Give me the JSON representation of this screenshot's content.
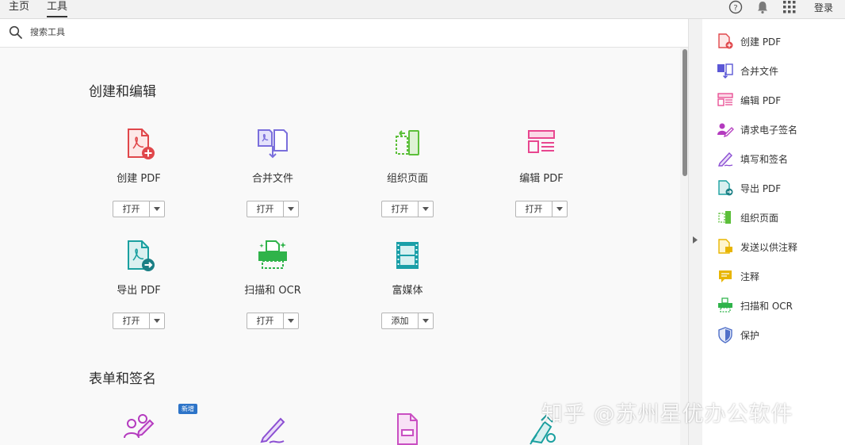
{
  "topbar": {
    "tabs": [
      {
        "label": "主页",
        "active": false
      },
      {
        "label": "工具",
        "active": true
      }
    ],
    "icons": [
      "help-icon",
      "bell-icon",
      "apps-grid-icon"
    ],
    "login_label": "登录"
  },
  "search": {
    "placeholder": "搜索工具"
  },
  "sections": [
    {
      "title": "创建和编辑",
      "tools": [
        {
          "name": "创建 PDF",
          "button": "打开",
          "icon": "create-pdf-icon",
          "color": "#e0474b"
        },
        {
          "name": "合并文件",
          "button": "打开",
          "icon": "combine-files-icon",
          "color": "#7a6fdc"
        },
        {
          "name": "组织页面",
          "button": "打开",
          "icon": "organize-pages-icon",
          "color": "#5cbf3a"
        },
        {
          "name": "编辑 PDF",
          "button": "打开",
          "icon": "edit-pdf-icon",
          "color": "#e8468f"
        },
        {
          "name": "导出 PDF",
          "button": "打开",
          "icon": "export-pdf-icon",
          "color": "#1aa0a0"
        },
        {
          "name": "扫描和 OCR",
          "button": "打开",
          "icon": "scan-ocr-icon",
          "color": "#2fb34a"
        },
        {
          "name": "富媒体",
          "button": "添加",
          "icon": "rich-media-icon",
          "color": "#1a9fa8"
        }
      ]
    },
    {
      "title": "表单和签名",
      "tools": [
        {
          "icon": "request-esign-icon",
          "color": "#b43bbf",
          "badge": "新增"
        },
        {
          "icon": "fill-sign-icon",
          "color": "#8c4fd3"
        },
        {
          "icon": "prepare-form-icon",
          "color": "#c94fc2"
        },
        {
          "icon": "certificates-icon",
          "color": "#1aa0a0"
        }
      ]
    }
  ],
  "right_pane": {
    "items": [
      {
        "label": "创建 PDF",
        "icon": "create-pdf-icon",
        "color": "#e0474b"
      },
      {
        "label": "合并文件",
        "icon": "combine-files-icon",
        "color": "#5b57d6"
      },
      {
        "label": "编辑 PDF",
        "icon": "edit-pdf-icon",
        "color": "#e8468f"
      },
      {
        "label": "请求电子签名",
        "icon": "request-esign-icon",
        "color": "#b43bbf"
      },
      {
        "label": "填写和签名",
        "icon": "fill-sign-icon",
        "color": "#8c4fd3"
      },
      {
        "label": "导出 PDF",
        "icon": "export-pdf-icon",
        "color": "#1aa0a0"
      },
      {
        "label": "组织页面",
        "icon": "organize-pages-icon",
        "color": "#5cbf3a"
      },
      {
        "label": "发送以供注释",
        "icon": "send-comment-icon",
        "color": "#e8b500"
      },
      {
        "label": "注释",
        "icon": "comment-icon",
        "color": "#e8b500"
      },
      {
        "label": "扫描和 OCR",
        "icon": "scan-ocr-icon",
        "color": "#2fb34a"
      },
      {
        "label": "保护",
        "icon": "protect-icon",
        "color": "#4f6fc8"
      }
    ]
  },
  "watermark": "知乎 @苏州星优办公软件"
}
